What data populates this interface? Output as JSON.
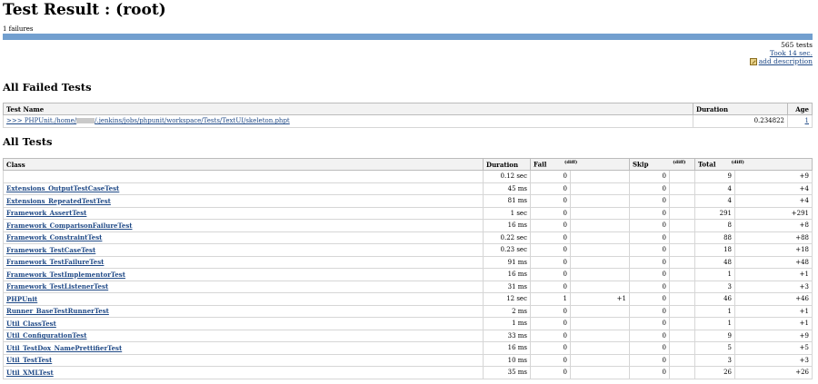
{
  "page": {
    "title": "Test Result : (root)",
    "failures_label": "1 failures",
    "pass_fraction": 1.0
  },
  "summary": {
    "tests": "565 tests",
    "took": "Took 14 sec.",
    "add_description": "add description"
  },
  "failed_section": {
    "heading": "All Failed Tests",
    "columns": [
      "Test Name",
      "Duration",
      "Age"
    ],
    "rows": [
      {
        "prefix": ">>> PHPUnit./home/",
        "suffix": "/.jenkins/jobs/phpunit/workspace/Tests/TextUI/skeleton.phpt",
        "duration": "0.234822",
        "age": "1"
      }
    ]
  },
  "all_section": {
    "heading": "All Tests",
    "columns": {
      "class": "Class",
      "duration": "Duration",
      "fail": "Fail",
      "skip": "Skip",
      "total": "Total",
      "diff": "(diff)"
    },
    "rows": [
      {
        "name": "",
        "duration": "0.12 sec",
        "fail": "0",
        "fail_diff": "",
        "skip": "0",
        "skip_diff": "",
        "total": "9",
        "total_diff": "+9"
      },
      {
        "name": "Extensions_OutputTestCaseTest",
        "duration": "45 ms",
        "fail": "0",
        "fail_diff": "",
        "skip": "0",
        "skip_diff": "",
        "total": "4",
        "total_diff": "+4"
      },
      {
        "name": "Extensions_RepeatedTestTest",
        "duration": "81 ms",
        "fail": "0",
        "fail_diff": "",
        "skip": "0",
        "skip_diff": "",
        "total": "4",
        "total_diff": "+4"
      },
      {
        "name": "Framework_AssertTest",
        "duration": "1 sec",
        "fail": "0",
        "fail_diff": "",
        "skip": "0",
        "skip_diff": "",
        "total": "291",
        "total_diff": "+291"
      },
      {
        "name": "Framework_ComparisonFailureTest",
        "duration": "16 ms",
        "fail": "0",
        "fail_diff": "",
        "skip": "0",
        "skip_diff": "",
        "total": "8",
        "total_diff": "+8"
      },
      {
        "name": "Framework_ConstraintTest",
        "duration": "0.22 sec",
        "fail": "0",
        "fail_diff": "",
        "skip": "0",
        "skip_diff": "",
        "total": "88",
        "total_diff": "+88"
      },
      {
        "name": "Framework_TestCaseTest",
        "duration": "0.23 sec",
        "fail": "0",
        "fail_diff": "",
        "skip": "0",
        "skip_diff": "",
        "total": "18",
        "total_diff": "+18"
      },
      {
        "name": "Framework_TestFailureTest",
        "duration": "91 ms",
        "fail": "0",
        "fail_diff": "",
        "skip": "0",
        "skip_diff": "",
        "total": "48",
        "total_diff": "+48"
      },
      {
        "name": "Framework_TestImplementorTest",
        "duration": "16 ms",
        "fail": "0",
        "fail_diff": "",
        "skip": "0",
        "skip_diff": "",
        "total": "1",
        "total_diff": "+1"
      },
      {
        "name": "Framework_TestListenerTest",
        "duration": "31 ms",
        "fail": "0",
        "fail_diff": "",
        "skip": "0",
        "skip_diff": "",
        "total": "3",
        "total_diff": "+3"
      },
      {
        "name": "PHPUnit",
        "duration": "12 sec",
        "fail": "1",
        "fail_diff": "+1",
        "skip": "0",
        "skip_diff": "",
        "total": "46",
        "total_diff": "+46"
      },
      {
        "name": "Runner_BaseTestRunnerTest",
        "duration": "2 ms",
        "fail": "0",
        "fail_diff": "",
        "skip": "0",
        "skip_diff": "",
        "total": "1",
        "total_diff": "+1"
      },
      {
        "name": "Util_ClassTest",
        "duration": "1 ms",
        "fail": "0",
        "fail_diff": "",
        "skip": "0",
        "skip_diff": "",
        "total": "1",
        "total_diff": "+1"
      },
      {
        "name": "Util_ConfigurationTest",
        "duration": "33 ms",
        "fail": "0",
        "fail_diff": "",
        "skip": "0",
        "skip_diff": "",
        "total": "9",
        "total_diff": "+9"
      },
      {
        "name": "Util_TestDox_NamePrettifierTest",
        "duration": "16 ms",
        "fail": "0",
        "fail_diff": "",
        "skip": "0",
        "skip_diff": "",
        "total": "5",
        "total_diff": "+5"
      },
      {
        "name": "Util_TestTest",
        "duration": "10 ms",
        "fail": "0",
        "fail_diff": "",
        "skip": "0",
        "skip_diff": "",
        "total": "3",
        "total_diff": "+3"
      },
      {
        "name": "Util_XMLTest",
        "duration": "35 ms",
        "fail": "0",
        "fail_diff": "",
        "skip": "0",
        "skip_diff": "",
        "total": "26",
        "total_diff": "+26"
      }
    ]
  },
  "colors": {
    "bar": "#729fcf",
    "link": "#204a87"
  }
}
